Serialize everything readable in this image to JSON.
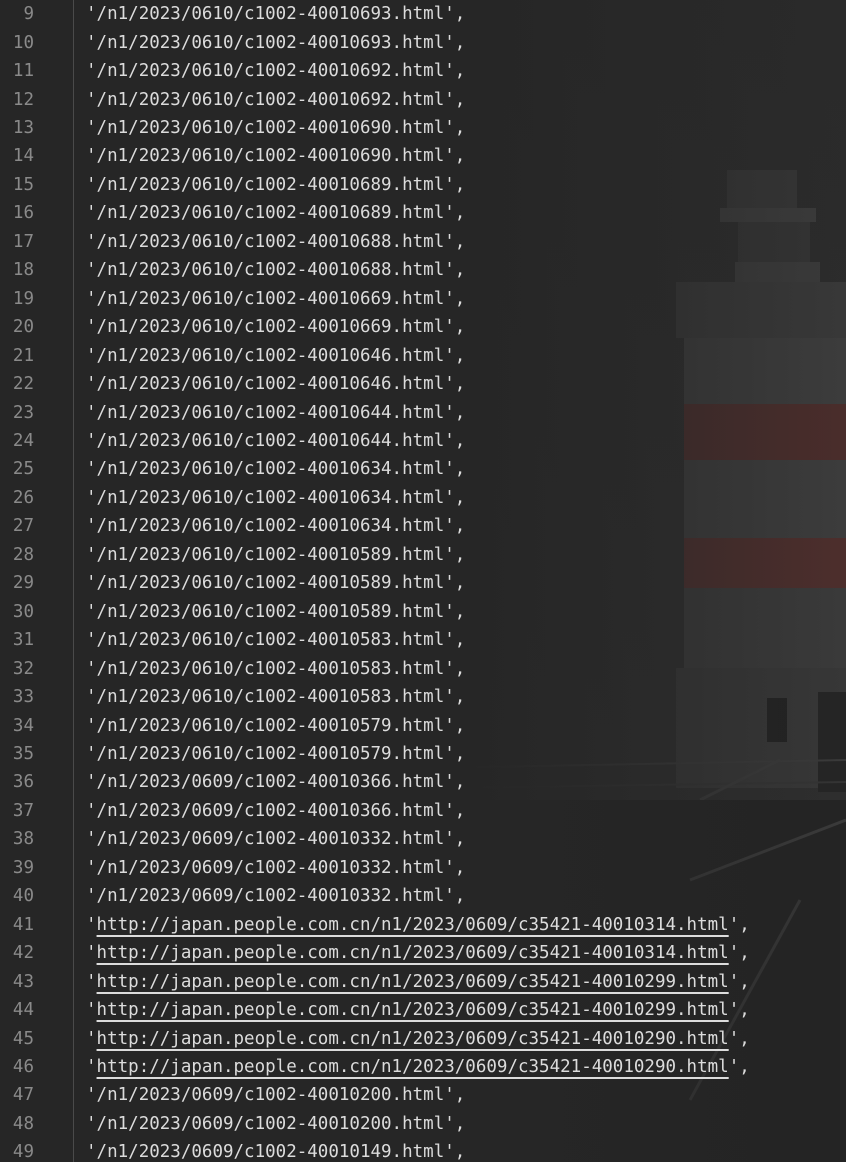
{
  "editor": {
    "colors": {
      "background": "#262626",
      "text": "#dcdcdc",
      "line_number": "#8a8a8a"
    },
    "lines": [
      {
        "number": "9",
        "prefix": "'",
        "url": "",
        "path": "/n1/2023/0610/c1002-40010693.html",
        "suffix": "',"
      },
      {
        "number": "10",
        "prefix": "'",
        "url": "",
        "path": "/n1/2023/0610/c1002-40010693.html",
        "suffix": "',"
      },
      {
        "number": "11",
        "prefix": "'",
        "url": "",
        "path": "/n1/2023/0610/c1002-40010692.html",
        "suffix": "',"
      },
      {
        "number": "12",
        "prefix": "'",
        "url": "",
        "path": "/n1/2023/0610/c1002-40010692.html",
        "suffix": "',"
      },
      {
        "number": "13",
        "prefix": "'",
        "url": "",
        "path": "/n1/2023/0610/c1002-40010690.html",
        "suffix": "',"
      },
      {
        "number": "14",
        "prefix": "'",
        "url": "",
        "path": "/n1/2023/0610/c1002-40010690.html",
        "suffix": "',"
      },
      {
        "number": "15",
        "prefix": "'",
        "url": "",
        "path": "/n1/2023/0610/c1002-40010689.html",
        "suffix": "',"
      },
      {
        "number": "16",
        "prefix": "'",
        "url": "",
        "path": "/n1/2023/0610/c1002-40010689.html",
        "suffix": "',"
      },
      {
        "number": "17",
        "prefix": "'",
        "url": "",
        "path": "/n1/2023/0610/c1002-40010688.html",
        "suffix": "',"
      },
      {
        "number": "18",
        "prefix": "'",
        "url": "",
        "path": "/n1/2023/0610/c1002-40010688.html",
        "suffix": "',"
      },
      {
        "number": "19",
        "prefix": "'",
        "url": "",
        "path": "/n1/2023/0610/c1002-40010669.html",
        "suffix": "',"
      },
      {
        "number": "20",
        "prefix": "'",
        "url": "",
        "path": "/n1/2023/0610/c1002-40010669.html",
        "suffix": "',"
      },
      {
        "number": "21",
        "prefix": "'",
        "url": "",
        "path": "/n1/2023/0610/c1002-40010646.html",
        "suffix": "',"
      },
      {
        "number": "22",
        "prefix": "'",
        "url": "",
        "path": "/n1/2023/0610/c1002-40010646.html",
        "suffix": "',"
      },
      {
        "number": "23",
        "prefix": "'",
        "url": "",
        "path": "/n1/2023/0610/c1002-40010644.html",
        "suffix": "',"
      },
      {
        "number": "24",
        "prefix": "'",
        "url": "",
        "path": "/n1/2023/0610/c1002-40010644.html",
        "suffix": "',"
      },
      {
        "number": "25",
        "prefix": "'",
        "url": "",
        "path": "/n1/2023/0610/c1002-40010634.html",
        "suffix": "',"
      },
      {
        "number": "26",
        "prefix": "'",
        "url": "",
        "path": "/n1/2023/0610/c1002-40010634.html",
        "suffix": "',"
      },
      {
        "number": "27",
        "prefix": "'",
        "url": "",
        "path": "/n1/2023/0610/c1002-40010634.html",
        "suffix": "',"
      },
      {
        "number": "28",
        "prefix": "'",
        "url": "",
        "path": "/n1/2023/0610/c1002-40010589.html",
        "suffix": "',"
      },
      {
        "number": "29",
        "prefix": "'",
        "url": "",
        "path": "/n1/2023/0610/c1002-40010589.html",
        "suffix": "',"
      },
      {
        "number": "30",
        "prefix": "'",
        "url": "",
        "path": "/n1/2023/0610/c1002-40010589.html",
        "suffix": "',"
      },
      {
        "number": "31",
        "prefix": "'",
        "url": "",
        "path": "/n1/2023/0610/c1002-40010583.html",
        "suffix": "',"
      },
      {
        "number": "32",
        "prefix": "'",
        "url": "",
        "path": "/n1/2023/0610/c1002-40010583.html",
        "suffix": "',"
      },
      {
        "number": "33",
        "prefix": "'",
        "url": "",
        "path": "/n1/2023/0610/c1002-40010583.html",
        "suffix": "',"
      },
      {
        "number": "34",
        "prefix": "'",
        "url": "",
        "path": "/n1/2023/0610/c1002-40010579.html",
        "suffix": "',"
      },
      {
        "number": "35",
        "prefix": "'",
        "url": "",
        "path": "/n1/2023/0610/c1002-40010579.html",
        "suffix": "',"
      },
      {
        "number": "36",
        "prefix": "'",
        "url": "",
        "path": "/n1/2023/0609/c1002-40010366.html",
        "suffix": "',"
      },
      {
        "number": "37",
        "prefix": "'",
        "url": "",
        "path": "/n1/2023/0609/c1002-40010366.html",
        "suffix": "',"
      },
      {
        "number": "38",
        "prefix": "'",
        "url": "",
        "path": "/n1/2023/0609/c1002-40010332.html",
        "suffix": "',"
      },
      {
        "number": "39",
        "prefix": "'",
        "url": "",
        "path": "/n1/2023/0609/c1002-40010332.html",
        "suffix": "',"
      },
      {
        "number": "40",
        "prefix": "'",
        "url": "",
        "path": "/n1/2023/0609/c1002-40010332.html",
        "suffix": "',"
      },
      {
        "number": "41",
        "prefix": "'",
        "url": "http://japan.people.com.cn/n1/2023/0609/c35421-40010314.html",
        "path": "",
        "suffix": "',"
      },
      {
        "number": "42",
        "prefix": "'",
        "url": "http://japan.people.com.cn/n1/2023/0609/c35421-40010314.html",
        "path": "",
        "suffix": "',"
      },
      {
        "number": "43",
        "prefix": "'",
        "url": "http://japan.people.com.cn/n1/2023/0609/c35421-40010299.html",
        "path": "",
        "suffix": "',"
      },
      {
        "number": "44",
        "prefix": "'",
        "url": "http://japan.people.com.cn/n1/2023/0609/c35421-40010299.html",
        "path": "",
        "suffix": "',"
      },
      {
        "number": "45",
        "prefix": "'",
        "url": "http://japan.people.com.cn/n1/2023/0609/c35421-40010290.html",
        "path": "",
        "suffix": "',"
      },
      {
        "number": "46",
        "prefix": "'",
        "url": "http://japan.people.com.cn/n1/2023/0609/c35421-40010290.html",
        "path": "",
        "suffix": "',"
      },
      {
        "number": "47",
        "prefix": "'",
        "url": "",
        "path": "/n1/2023/0609/c1002-40010200.html",
        "suffix": "',"
      },
      {
        "number": "48",
        "prefix": "'",
        "url": "",
        "path": "/n1/2023/0609/c1002-40010200.html",
        "suffix": "',"
      },
      {
        "number": "49",
        "prefix": "'",
        "url": "",
        "path": "/n1/2023/0609/c1002-40010149.html",
        "suffix": "',"
      }
    ]
  }
}
